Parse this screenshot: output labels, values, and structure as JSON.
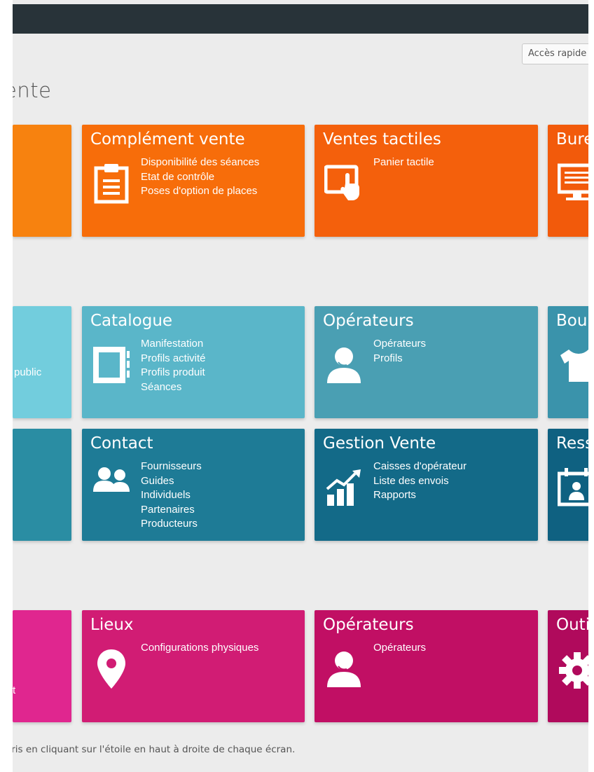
{
  "header": {
    "quick_access_placeholder": "Accès rapide"
  },
  "page": {
    "title": "ente"
  },
  "rows": {
    "row1": {
      "tile_left_partial": {
        "color": "#f7820f"
      },
      "complement_vente": {
        "title": "Complément vente",
        "icon": "clipboard-icon",
        "color": "#f76d0a",
        "links": [
          "Disponibilité des séances",
          "Etat de contrôle",
          "Poses d'option de places"
        ]
      },
      "ventes_tactiles": {
        "title": "Ventes tactiles",
        "icon": "touch-screen-icon",
        "color": "#f4600c",
        "links": [
          "Panier tactile"
        ]
      },
      "bureau_partial": {
        "title": "Bure",
        "icon": "monitor-icon",
        "color": "#f25a0b"
      }
    },
    "row2": {
      "tile_left_partial": {
        "text": "public",
        "color": "#72cddd"
      },
      "catalogue": {
        "title": "Catalogue",
        "icon": "catalog-icon",
        "color": "#5ab6c9",
        "links": [
          "Manifestation",
          "Profils activité",
          "Profils produit",
          "Séances"
        ]
      },
      "operateurs": {
        "title": "Opérateurs",
        "icon": "operator-headset-icon",
        "color": "#4a9fb3",
        "links": [
          "Opérateurs",
          "Profils"
        ]
      },
      "boutique_partial": {
        "title": "Bou",
        "icon": "tshirt-icon",
        "color": "#3a93ab"
      }
    },
    "row3": {
      "tile_left_partial": {
        "color": "#2a8da3"
      },
      "contact": {
        "title": "Contact",
        "icon": "people-icon",
        "color": "#1e7b96",
        "links": [
          "Fournisseurs",
          "Guides",
          "Individuels",
          "Partenaires",
          "Producteurs"
        ]
      },
      "gestion_vente": {
        "title": "Gestion Vente",
        "icon": "growth-chart-icon",
        "color": "#136a88",
        "links": [
          "Caisses d'opérateur",
          "Liste des envois",
          "Rapports"
        ]
      },
      "ressources_partial": {
        "title": "Ress",
        "icon": "calendar-person-icon",
        "color": "#0f6181"
      }
    },
    "row4": {
      "tile_left_partial": {
        "text": "t",
        "color": "#e0268f"
      },
      "lieux": {
        "title": "Lieux",
        "icon": "location-pin-icon",
        "color": "#d11c74",
        "links": [
          "Configurations physiques"
        ]
      },
      "operateurs": {
        "title": "Opérateurs",
        "icon": "operator-headset-icon",
        "color": "#c10f64",
        "links": [
          "Opérateurs"
        ]
      },
      "outils_partial": {
        "title": "Outi",
        "icon": "gear-icon",
        "color": "#b00a5c"
      }
    }
  },
  "footer": {
    "note": "oris en cliquant sur l'étoile en haut à droite de chaque écran."
  }
}
